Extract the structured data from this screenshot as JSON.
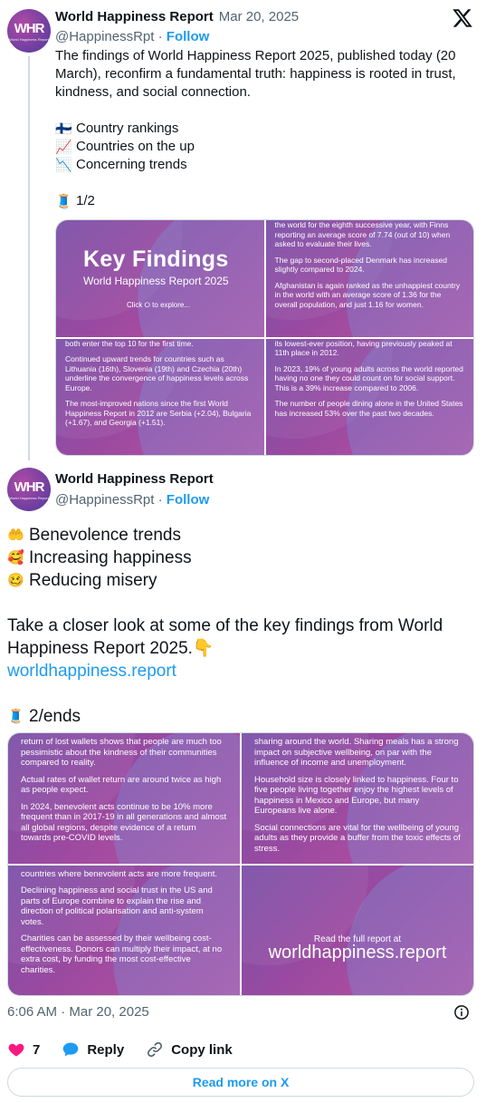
{
  "tweet1": {
    "author_name": "World Happiness Report",
    "date": "Mar 20, 2025",
    "handle": "@HappinessRpt",
    "follow_label": "Follow",
    "avatar_text": "WHR",
    "avatar_sub": "World Happiness Report",
    "text_intro": "The findings of World Happiness Report 2025, published today (20 March), reconfirm a fundamental truth: happiness is rooted in trust, kindness, and social connection.",
    "bullets": [
      {
        "emoji": "🇫🇮",
        "text": "Country rankings"
      },
      {
        "emoji": "📈",
        "text": "Countries on the up"
      },
      {
        "emoji": "📉",
        "text": "Concerning trends"
      }
    ],
    "thread_marker": {
      "emoji": "🧵",
      "text": "1/2"
    }
  },
  "image1": {
    "tile1": {
      "title": "Key Findings",
      "subtitle": "World Happiness Report 2025",
      "cta": "Click ⭘ to explore..."
    },
    "tile2": [
      "the world for the eighth successive year, with Finns reporting an average score of 7.74 (out of 10) when asked to evaluate their lives.",
      "The gap to second-placed Denmark has increased slightly compared to 2024.",
      "Afghanistan is again ranked as the unhappiest country in the world with an average score of 1.36 for the overall population, and just 1.16 for women."
    ],
    "tile3": [
      "both enter the top 10 for the first time.",
      "Continued upward trends for countries such as Lithuania (16th), Slovenia (19th) and Czechia (20th) underline the convergence of happiness levels across Europe.",
      "The most-improved nations since the first World Happiness Report in 2012 are Serbia (+2.04), Bulgaria (+1.67), and Georgia (+1.51)."
    ],
    "tile4": [
      "its lowest-ever position, having previously peaked at 11th place in 2012.",
      "In 2023, 19% of young adults across the world reported having no one they could count on for social support. This is a 39% increase compared to 2006.",
      "The number of people dining alone in the United States has increased 53% over the past two decades."
    ]
  },
  "tweet2": {
    "author_name": "World Happiness Report",
    "handle": "@HappinessRpt",
    "follow_label": "Follow",
    "avatar_text": "WHR",
    "avatar_sub": "World Happiness Report",
    "bullets": [
      {
        "emoji": "🤲",
        "text": "Benevolence trends"
      },
      {
        "emoji": "🥰",
        "text": "Increasing happiness"
      },
      {
        "emoji": "🥴",
        "text": "Reducing misery"
      }
    ],
    "text_main": "Take a closer look at some of the key findings from World Happiness Report 2025.",
    "pointing_emoji": "👇",
    "link": "worldhappiness.report",
    "thread_marker": {
      "emoji": "🧵",
      "text": "2/ends"
    }
  },
  "image2": {
    "tile1": [
      "return of lost wallets shows that people are much too pessimistic about the kindness of their communities compared to reality.",
      "Actual rates of wallet return are around twice as high as people expect.",
      "In 2024, benevolent acts continue to be 10% more frequent than in 2017-19 in all generations and almost all global regions, despite evidence of a return towards pre-COVID levels."
    ],
    "tile2": [
      "sharing around the world. Sharing meals has a strong impact on subjective wellbeing, on par with the influence of income and unemployment.",
      "Household size is closely linked to happiness. Four to five people living together enjoy the highest levels of happiness in Mexico and Europe, but many Europeans live alone.",
      "Social connections are vital for the wellbeing of young adults as they provide a buffer from the toxic effects of stress."
    ],
    "tile3": [
      "countries where benevolent acts are more frequent.",
      "Declining happiness and social trust in the US and parts of Europe combine to explain the rise and direction of political polarisation and anti-system votes.",
      "Charities can be assessed by their wellbeing cost-effectiveness. Donors can multiply their impact, at no extra cost, by funding the most cost-effective charities."
    ],
    "tile4": {
      "small": "Read the full report at",
      "big": "worldhappiness.report"
    }
  },
  "footer": {
    "timestamp": "6:06 AM · Mar 20, 2025",
    "likes": "7",
    "reply_label": "Reply",
    "copy_label": "Copy link",
    "read_more": "Read more on X"
  },
  "colors": {
    "accent": "#1d9bf0",
    "like": "#f91880",
    "muted": "#536471",
    "brand_purple": "#8e4aa2"
  }
}
